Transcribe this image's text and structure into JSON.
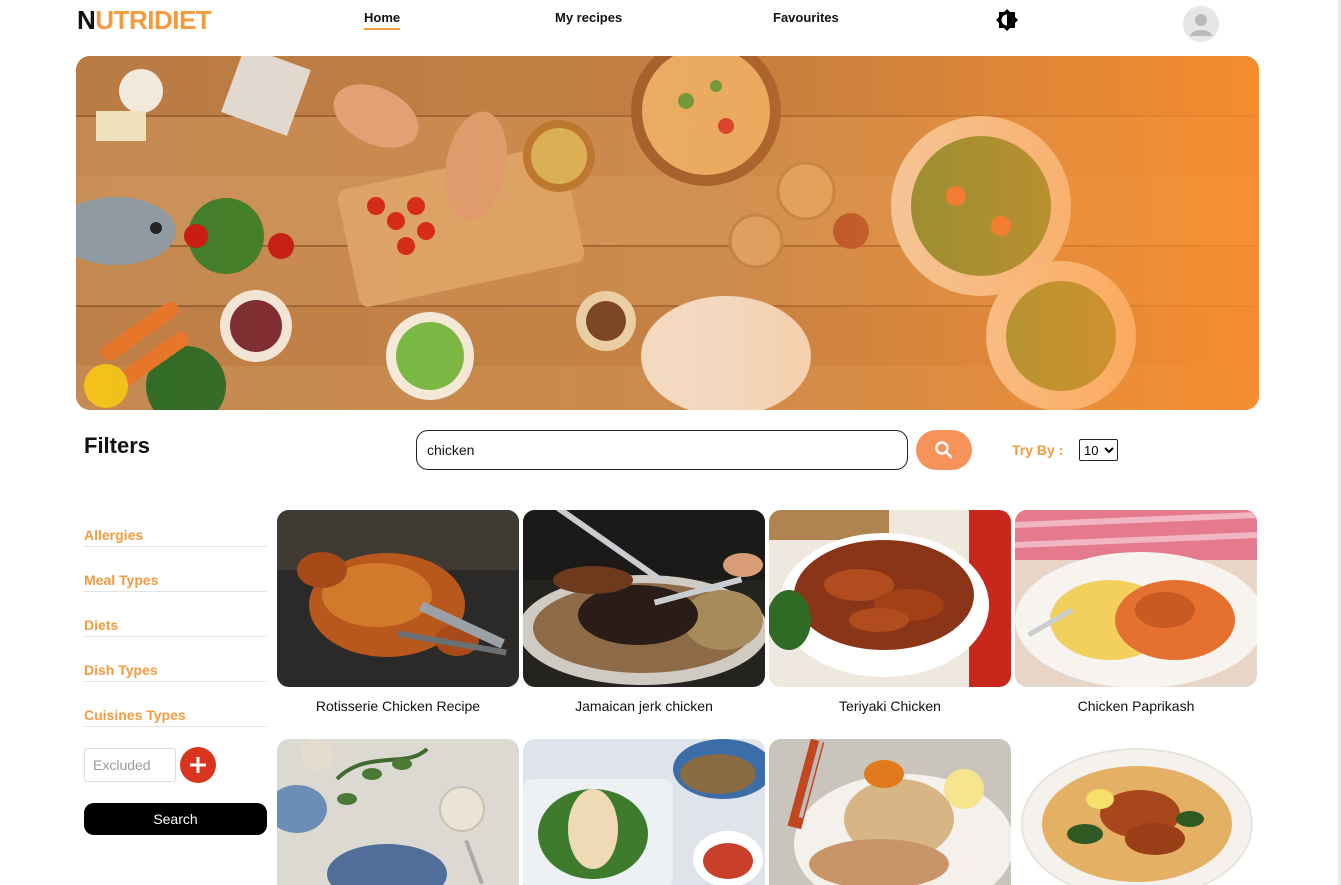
{
  "header": {
    "logo_first": "N",
    "logo_rest": "UTRIDIET",
    "nav": [
      {
        "label": "Home",
        "active": true
      },
      {
        "label": "My recipes",
        "active": false
      },
      {
        "label": "Favourites",
        "active": false
      }
    ],
    "theme_icon": "brightness-icon",
    "avatar_icon": "user-avatar-icon"
  },
  "hero": {
    "image": "food-table-banner"
  },
  "search": {
    "title": "Filters",
    "value": "chicken",
    "button_icon": "search-icon",
    "try_by_label": "Try By :",
    "try_by_value": "10"
  },
  "sidebar": {
    "filters": [
      "Allergies",
      "Meal Types",
      "Diets",
      "Dish Types",
      "Cuisines Types"
    ],
    "excluded_placeholder": "Excluded",
    "add_icon": "plus-icon",
    "search_label": "Search"
  },
  "recipes": [
    {
      "title": "Rotisserie Chicken Recipe"
    },
    {
      "title": "Jamaican jerk chicken"
    },
    {
      "title": "Teriyaki Chicken"
    },
    {
      "title": "Chicken Paprikash"
    },
    {
      "title": ""
    },
    {
      "title": ""
    },
    {
      "title": ""
    },
    {
      "title": ""
    }
  ],
  "colors": {
    "accent": "#f59a3e",
    "search_button": "#f5935a",
    "add_button": "#d8341e",
    "dark_button": "#000000"
  }
}
